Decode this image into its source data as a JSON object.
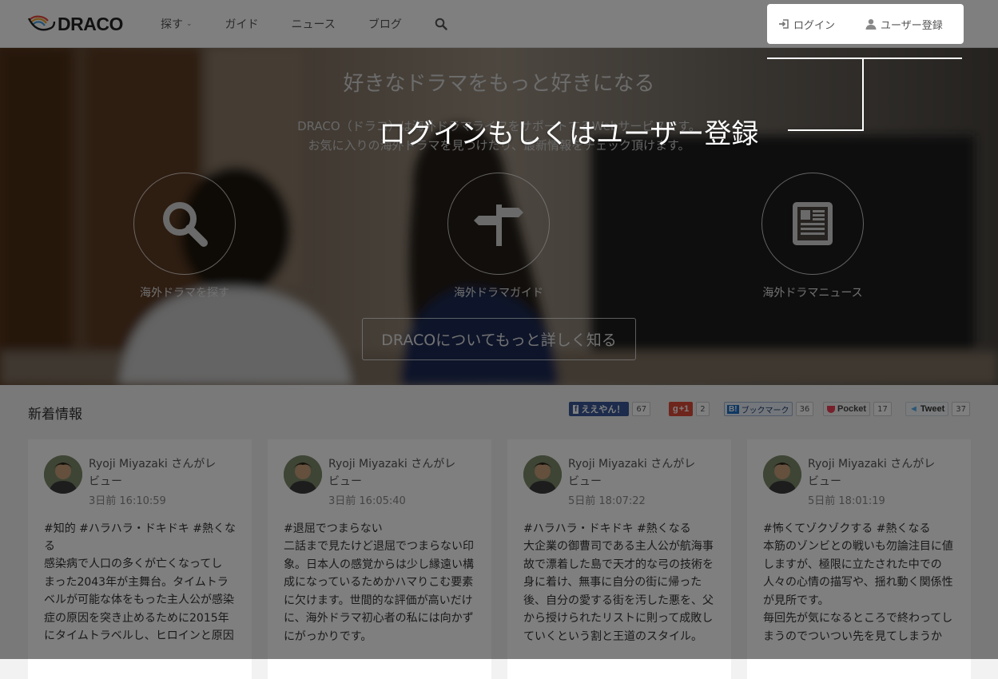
{
  "header": {
    "logo_text": "DRACO",
    "nav": [
      {
        "label": "探す",
        "has_dropdown": true
      },
      {
        "label": "ガイド"
      },
      {
        "label": "ニュース"
      },
      {
        "label": "ブログ"
      }
    ],
    "login_label": "ログイン",
    "register_label": "ユーザー登録"
  },
  "hero": {
    "title": "好きなドラマをもっと好きになる",
    "desc_line1": "DRACO（ドラコ）は海外ドラマライフをサポートするWebサービスです。",
    "desc_line2": "お気に入りの海外ドラマを見つけたり、最新情報をチェック頂けます。",
    "features": [
      {
        "label": "海外ドラマを探す",
        "icon": "search-icon"
      },
      {
        "label": "海外ドラマガイド",
        "icon": "signpost-icon"
      },
      {
        "label": "海外ドラマニュース",
        "icon": "newspaper-icon"
      }
    ],
    "about_button": "DRACOについてもっと詳しく知る"
  },
  "news": {
    "section_title": "新着情報",
    "share": [
      {
        "label": "ええやん！",
        "count": "67",
        "color": "#3b5998",
        "icon": "facebook-icon"
      },
      {
        "label": "+1",
        "count": "2",
        "color": "#dd4b39",
        "icon": "google-plus-icon"
      },
      {
        "label": "ブックマーク",
        "count": "36",
        "color": "#1f6ec7",
        "icon": "hatena-icon"
      },
      {
        "label": "Pocket",
        "count": "17",
        "color": "#ee4056",
        "icon": "pocket-icon"
      },
      {
        "label": "Tweet",
        "count": "37",
        "color": "#55acee",
        "icon": "twitter-icon"
      }
    ],
    "cards": [
      {
        "user_line1": "Ryoji Miyazaki さんがレ",
        "user_line2": "ビュー",
        "time": "3日前 16:10:59",
        "tags_line1": "#知的 #ハラハラ・ドキドキ #熱くな",
        "tags_line2": "る",
        "lines": [
          "感染病で人口の多くが亡くなってし",
          "まった2043年が主舞台。タイムトラ",
          "ベルが可能な体をもった主人公が感染",
          "症の原因を突き止めるために2015年",
          "にタイムトラベルし、ヒロインと原因"
        ]
      },
      {
        "user_line1": "Ryoji Miyazaki さんがレ",
        "user_line2": "ビュー",
        "time": "3日前 16:05:40",
        "tags_line1": "#退屈でつまらない",
        "tags_line2": "",
        "lines": [
          "二話まで見たけど退屈でつまらない印",
          "象。日本人の感覚からは少し縁遠い構",
          "成になっているためかハマりこむ要素",
          "に欠けます。世間的な評価が高いだけ",
          "に、海外ドラマ初心者の私には向かず",
          "にがっかりです。"
        ]
      },
      {
        "user_line1": "Ryoji Miyazaki さんがレ",
        "user_line2": "ビュー",
        "time": "5日前 18:07:22",
        "tags_line1": "#ハラハラ・ドキドキ #熱くなる",
        "tags_line2": "",
        "lines": [
          "大企業の御曹司である主人公が航海事",
          "故で漂着した島で天才的な弓の技術を",
          "身に着け、無事に自分の街に帰った",
          "後、自分の愛する街を汚した悪を、父",
          "から授けられたリストに則って成敗し",
          "ていくという割と王道のスタイル。"
        ]
      },
      {
        "user_line1": "Ryoji Miyazaki さんがレ",
        "user_line2": "ビュー",
        "time": "5日前 18:01:19",
        "tags_line1": "#怖くてゾクゾクする #熱くなる",
        "tags_line2": "",
        "lines": [
          "本筋のゾンビとの戦いも勿論注目に値",
          "しますが、極限に立たされた中での",
          "人々の心情の描写や、揺れ動く関係性",
          "が見所です。",
          "毎回先が気になるところで終わってし",
          "まうのでついつい先を見てしまうか"
        ]
      }
    ]
  },
  "overlay": {
    "callout": "ログインもしくはユーザー登録"
  }
}
